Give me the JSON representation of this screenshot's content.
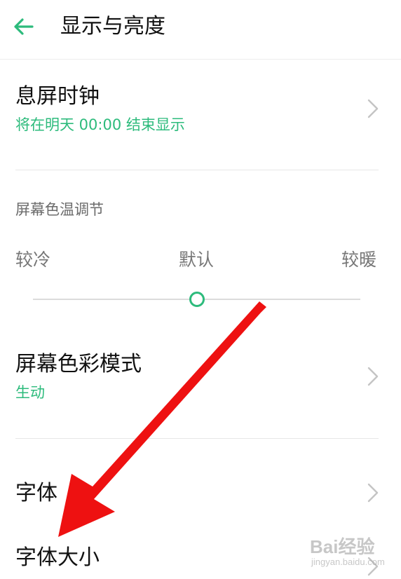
{
  "header": {
    "title": "显示与亮度",
    "back_icon": "back-arrow-icon"
  },
  "colors": {
    "accent": "#2dbb7c",
    "annotation_arrow": "#ee1111"
  },
  "rows": {
    "aod_clock": {
      "title": "息屏时钟",
      "subtitle": "将在明天  00:00 结束显示"
    },
    "color_mode": {
      "title": "屏幕色彩模式",
      "subtitle": "生动"
    },
    "font": {
      "title": "字体"
    },
    "font_size": {
      "title": "字体大小"
    }
  },
  "color_temperature": {
    "label": "屏幕色温调节",
    "cool_label": "较冷",
    "default_label": "默认",
    "warm_label": "较暖",
    "slider_value": 0.5
  },
  "watermark": {
    "main": "Bai经验",
    "sub": "jingyan.baidu.com"
  }
}
